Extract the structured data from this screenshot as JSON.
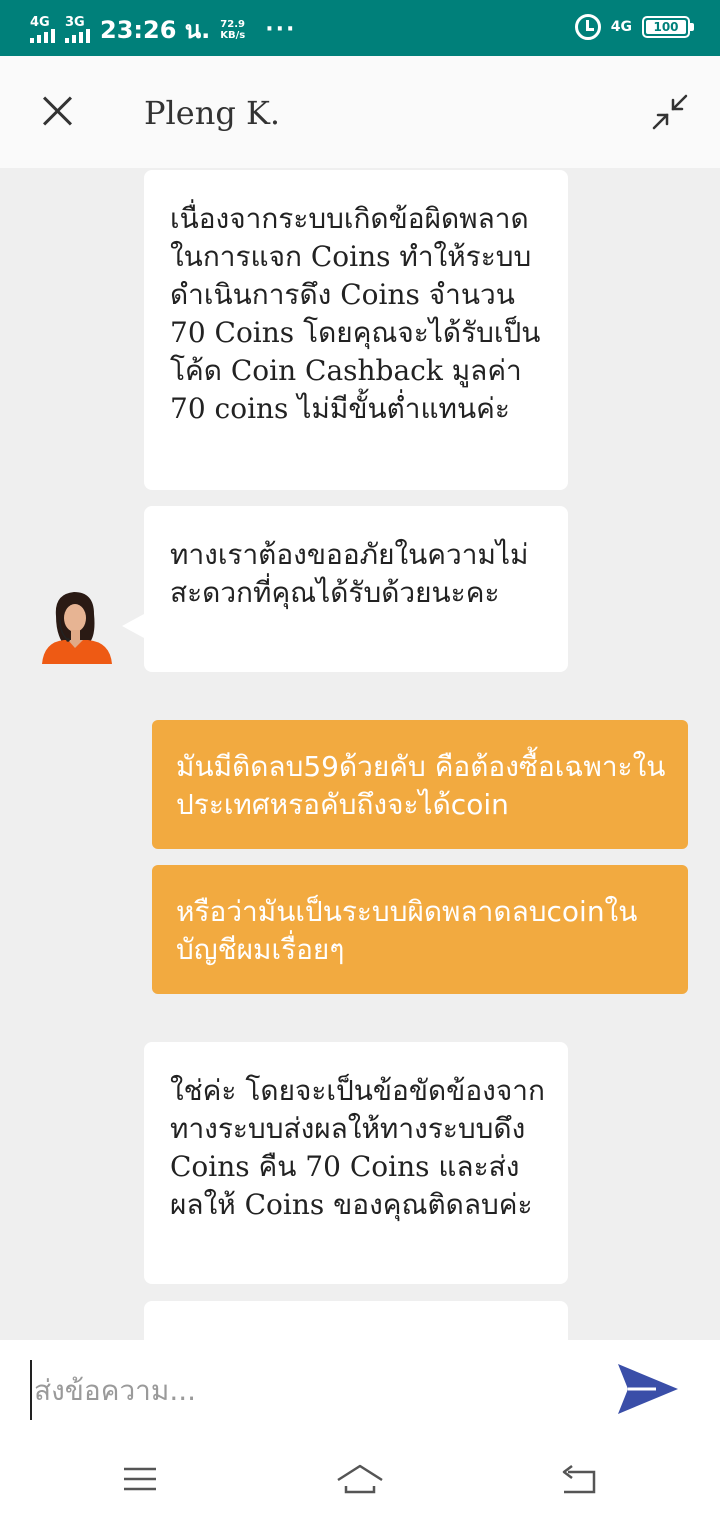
{
  "status_bar": {
    "sim1": "4G",
    "sim2": "3G",
    "time": "23:26 น.",
    "speed_value": "72.9",
    "speed_unit": "KB/s",
    "more": "···",
    "network": "4G",
    "battery": "100",
    "color": "#00807a"
  },
  "header": {
    "title": "Pleng K.",
    "close_icon": "close-icon",
    "minimize_icon": "minimize-icon"
  },
  "messages": [
    {
      "from": "agent",
      "text": "เนื่องจากระบบเกิดข้อผิดพลาดในการแจก Coins ทำให้ระบบดำเนินการดึง Coins จำนวน 70 Coins โดยคุณจะได้รับเป็นโค้ด Coin Cashback มูลค่า 70 coins ไม่มีขั้นต่ำแทนค่ะ"
    },
    {
      "from": "agent",
      "text": "ทางเราต้องขออภัยในความไม่สะดวกที่คุณได้รับด้วยนะคะ"
    },
    {
      "from": "user",
      "text": "มันมีติดลบ59ด้วยคับ คือต้องซื้อเฉพาะในประเทศหรอคับถึงจะได้coin"
    },
    {
      "from": "user",
      "text": "หรือว่ามันเป็นระบบผิดพลาดลบcoinในบัญชีผมเรื่อยๆ"
    },
    {
      "from": "agent",
      "text": "ใช่ค่ะ โดยจะเป็นข้อขัดข้องจากทางระบบส่งผลให้ทางระบบดึง Coins คืน 70 Coins และส่งผลให้ Coins ของคุณติดลบค่ะ"
    }
  ],
  "input": {
    "placeholder": "ส่งข้อความ...",
    "send_icon": "send-icon"
  },
  "colors": {
    "user_bubble": "#f2aa40",
    "agent_bubble": "#ffffff",
    "chat_bg": "#efefef",
    "send": "#3a4ea8"
  },
  "nav": {
    "menu_icon": "menu-icon",
    "home_icon": "home-icon",
    "back_icon": "back-icon"
  }
}
